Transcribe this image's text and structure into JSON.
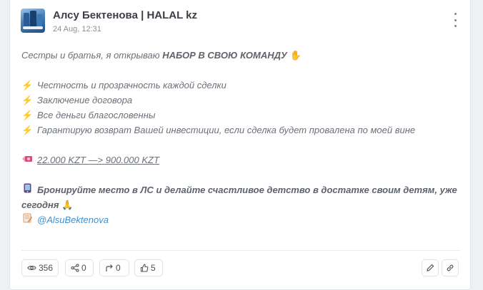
{
  "post": {
    "author": "Алсу Бектенова | HALAL kz",
    "datetime": "24 Aug, 12:31",
    "intro": "Сестры и братья, я открываю ",
    "intro_bold": "НАБОР В СВОЮ КОМАНДУ",
    "bullets": [
      "Честность и прозрачность каждой сделки",
      "Заключение договора",
      "Все деньги благословенны",
      "Гарантирую возврат Вашей инвестиции, если сделка будет провалена по моей вине"
    ],
    "money_line": "22.000 KZT —> 900.000 KZT",
    "booking_line1": "Бронируйте место в ЛС и делайте счастливое детство в достатке своим детям, уже",
    "booking_line2": "сегодня",
    "mention": "@AlsuBektenova"
  },
  "stats": {
    "views": "356",
    "shares": "0",
    "forwards": "0",
    "likes": "5"
  },
  "icons": {
    "menu": "more-vertical-icon",
    "bullet": "lightning-icon",
    "money": "money-wings-icon",
    "phone": "mobile-phone-icon",
    "memo": "memo-icon",
    "views": "eye-icon",
    "shares": "share-icon",
    "forwards": "forward-arrow-icon",
    "likes": "thumbs-up-icon",
    "edit": "pencil-icon",
    "link": "link-icon"
  },
  "colors": {
    "accent_link": "#3d8fd1",
    "bolt": "#f07a3a",
    "text": "#6b7079"
  }
}
